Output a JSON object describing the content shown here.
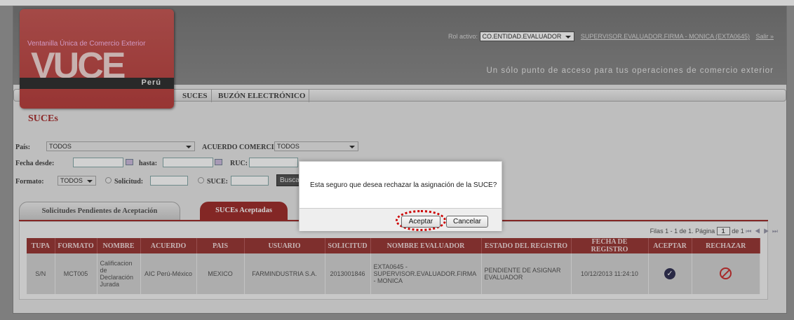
{
  "header": {
    "logo_sub": "Ventanilla Única de Comercio Exterior",
    "logo_text": "VUCE",
    "logo_country": "Perú",
    "rol_label": "Rol activo:",
    "rol_value": "CO.ENTIDAD.EVALUADOR",
    "user_link": "SUPERVISOR.EVALUADOR.FIRMA - MONICA (EXTA0645)",
    "logout": "Salir »",
    "tagline": "Un sólo punto de acceso para tus operaciones de comercio exterior"
  },
  "nav": {
    "items": [
      "SUCES",
      "BUZÓN ELECTRÓNICO"
    ]
  },
  "page_title": "SUCEs",
  "filters": {
    "pais_label": "País:",
    "pais_value": "TODOS",
    "acuerdo_label": "ACUERDO COMERCIAL:",
    "acuerdo_value": "TODOS",
    "fecha_desde_label": "Fecha desde:",
    "hasta_label": "hasta:",
    "ruc_label": "RUC:",
    "formato_label": "Formato:",
    "formato_value": "TODOS",
    "solicitud_label": "Solicitud:",
    "suce_label": "SUCE:",
    "buscar": "Busca"
  },
  "tabs": [
    "Solicitudes Pendientes de Aceptación",
    "SUCEs Aceptadas"
  ],
  "pager": {
    "rows": "Filas 1 - 1 de 1.",
    "page_label": "Página",
    "page": "1",
    "of": "de 1"
  },
  "table": {
    "headers": [
      "TUPA",
      "FORMATO",
      "NOMBRE",
      "ACUERDO",
      "PAIS",
      "USUARIO",
      "SOLICITUD",
      "NOMBRE EVALUADOR",
      "ESTADO DEL REGISTRO",
      "FECHA DE REGISTRO",
      "ACEPTAR",
      "RECHAZAR"
    ],
    "rows": [
      {
        "tupa": "S/N",
        "formato": "MCT005",
        "nombre": "Calificacion de Declaración Jurada",
        "acuerdo": "AIC Perú-México",
        "pais": "MEXICO",
        "usuario": "FARMINDUSTRIA S.A.",
        "solicitud": "2013001846",
        "evaluador": "EXTA0645 - SUPERVISOR.EVALUADOR.FIRMA - MONICA",
        "estado": "PENDIENTE DE ASIGNAR EVALUADOR",
        "fecha": "10/12/2013 11:24:10"
      }
    ]
  },
  "dialog": {
    "message": "Esta seguro que desea rechazar la asignación de la SUCE?",
    "accept": "Aceptar",
    "cancel": "Cancelar"
  }
}
